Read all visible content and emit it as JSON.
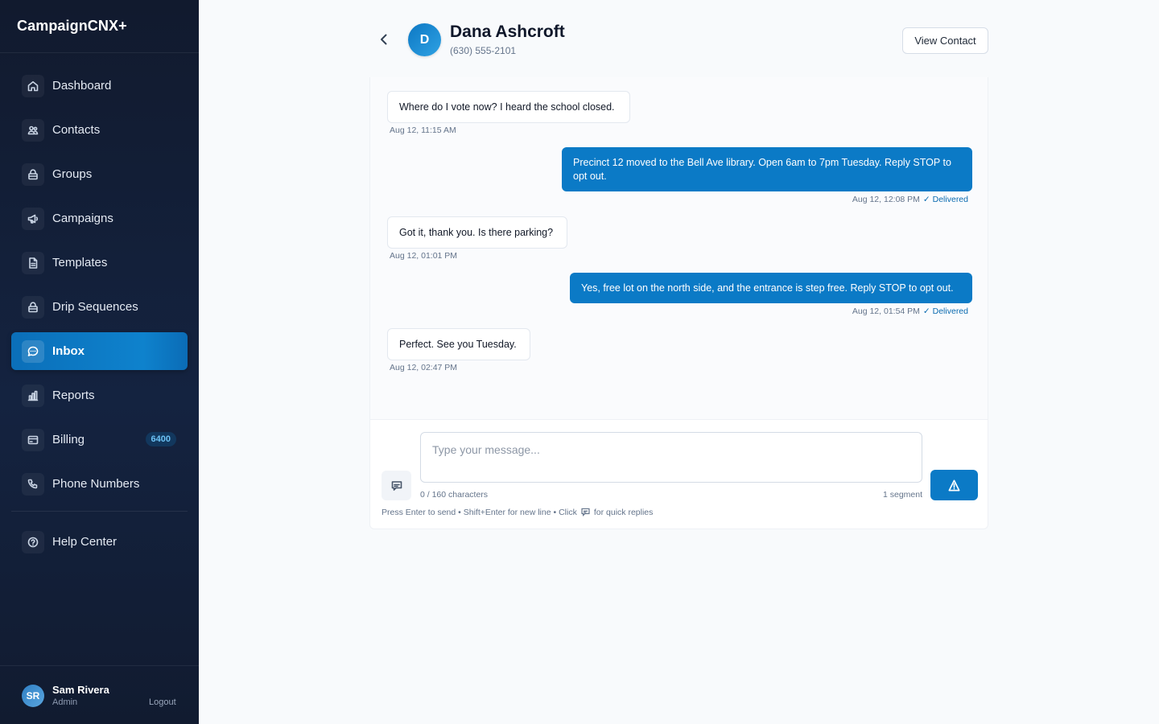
{
  "app": {
    "brand": "CampaignCNX+"
  },
  "sidebar": {
    "items": [
      {
        "label": "Dashboard",
        "icon": "home-icon"
      },
      {
        "label": "Contacts",
        "icon": "users-icon"
      },
      {
        "label": "Groups",
        "icon": "lock-icon"
      },
      {
        "label": "Campaigns",
        "icon": "megaphone-icon"
      },
      {
        "label": "Templates",
        "icon": "document-icon"
      },
      {
        "label": "Drip Sequences",
        "icon": "lock-icon"
      },
      {
        "label": "Inbox",
        "icon": "chat-icon",
        "active": true
      },
      {
        "label": "Reports",
        "icon": "bar-chart-icon"
      },
      {
        "label": "Billing",
        "icon": "card-icon",
        "badge": "6400"
      },
      {
        "label": "Phone Numbers",
        "icon": "phone-icon"
      }
    ],
    "help": {
      "label": "Help Center",
      "icon": "help-icon"
    },
    "user": {
      "initials": "SR",
      "name": "Sam Rivera",
      "role": "Admin",
      "logout": "Logout"
    }
  },
  "conversation": {
    "contact": {
      "initial": "D",
      "name": "Dana Ashcroft",
      "phone": "(630) 555-2101"
    },
    "view_contact_label": "View Contact",
    "messages": [
      {
        "direction": "in",
        "text": "Where do I vote now? I heard the school closed.",
        "time": "Aug 12, 11:15 AM"
      },
      {
        "direction": "out",
        "text": "Precinct 12 moved to the Bell Ave library. Open 6am to 7pm Tuesday. Reply STOP to opt out.",
        "time": "Aug 12, 12:08 PM",
        "status": "✓ Delivered"
      },
      {
        "direction": "in",
        "text": "Got it, thank you. Is there parking?",
        "time": "Aug 12, 01:01 PM"
      },
      {
        "direction": "out",
        "text": "Yes, free lot on the north side, and the entrance is step free. Reply STOP to opt out.",
        "time": "Aug 12, 01:54 PM",
        "status": "✓ Delivered"
      },
      {
        "direction": "in",
        "text": "Perfect. See you Tuesday.",
        "time": "Aug 12, 02:47 PM"
      }
    ]
  },
  "composer": {
    "placeholder": "Type your message...",
    "char_count": "0 / 160 characters",
    "segment": "1 segment",
    "hint_before": "Press Enter to send • Shift+Enter for new line • Click",
    "hint_after": "for quick replies"
  },
  "colors": {
    "accent": "#0b7ac6",
    "sidebar_bg": "#111a2e",
    "delivered": "#0b6bb0"
  }
}
